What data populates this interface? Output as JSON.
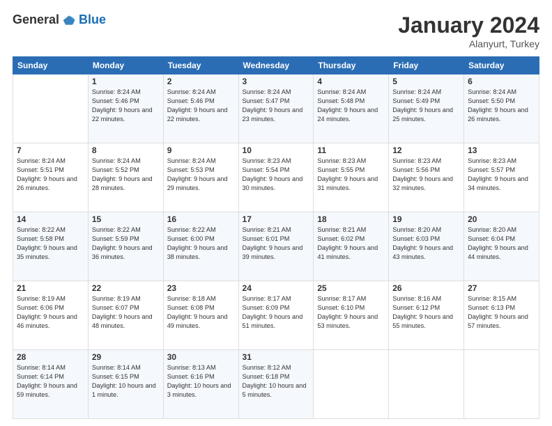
{
  "logo": {
    "general": "General",
    "blue": "Blue"
  },
  "header": {
    "month": "January 2024",
    "location": "Alanyurt, Turkey"
  },
  "weekdays": [
    "Sunday",
    "Monday",
    "Tuesday",
    "Wednesday",
    "Thursday",
    "Friday",
    "Saturday"
  ],
  "weeks": [
    [
      {
        "day": "",
        "sunrise": "",
        "sunset": "",
        "daylight": ""
      },
      {
        "day": "1",
        "sunrise": "Sunrise: 8:24 AM",
        "sunset": "Sunset: 5:46 PM",
        "daylight": "Daylight: 9 hours and 22 minutes."
      },
      {
        "day": "2",
        "sunrise": "Sunrise: 8:24 AM",
        "sunset": "Sunset: 5:46 PM",
        "daylight": "Daylight: 9 hours and 22 minutes."
      },
      {
        "day": "3",
        "sunrise": "Sunrise: 8:24 AM",
        "sunset": "Sunset: 5:47 PM",
        "daylight": "Daylight: 9 hours and 23 minutes."
      },
      {
        "day": "4",
        "sunrise": "Sunrise: 8:24 AM",
        "sunset": "Sunset: 5:48 PM",
        "daylight": "Daylight: 9 hours and 24 minutes."
      },
      {
        "day": "5",
        "sunrise": "Sunrise: 8:24 AM",
        "sunset": "Sunset: 5:49 PM",
        "daylight": "Daylight: 9 hours and 25 minutes."
      },
      {
        "day": "6",
        "sunrise": "Sunrise: 8:24 AM",
        "sunset": "Sunset: 5:50 PM",
        "daylight": "Daylight: 9 hours and 26 minutes."
      }
    ],
    [
      {
        "day": "7",
        "sunrise": "Sunrise: 8:24 AM",
        "sunset": "Sunset: 5:51 PM",
        "daylight": "Daylight: 9 hours and 26 minutes."
      },
      {
        "day": "8",
        "sunrise": "Sunrise: 8:24 AM",
        "sunset": "Sunset: 5:52 PM",
        "daylight": "Daylight: 9 hours and 28 minutes."
      },
      {
        "day": "9",
        "sunrise": "Sunrise: 8:24 AM",
        "sunset": "Sunset: 5:53 PM",
        "daylight": "Daylight: 9 hours and 29 minutes."
      },
      {
        "day": "10",
        "sunrise": "Sunrise: 8:23 AM",
        "sunset": "Sunset: 5:54 PM",
        "daylight": "Daylight: 9 hours and 30 minutes."
      },
      {
        "day": "11",
        "sunrise": "Sunrise: 8:23 AM",
        "sunset": "Sunset: 5:55 PM",
        "daylight": "Daylight: 9 hours and 31 minutes."
      },
      {
        "day": "12",
        "sunrise": "Sunrise: 8:23 AM",
        "sunset": "Sunset: 5:56 PM",
        "daylight": "Daylight: 9 hours and 32 minutes."
      },
      {
        "day": "13",
        "sunrise": "Sunrise: 8:23 AM",
        "sunset": "Sunset: 5:57 PM",
        "daylight": "Daylight: 9 hours and 34 minutes."
      }
    ],
    [
      {
        "day": "14",
        "sunrise": "Sunrise: 8:22 AM",
        "sunset": "Sunset: 5:58 PM",
        "daylight": "Daylight: 9 hours and 35 minutes."
      },
      {
        "day": "15",
        "sunrise": "Sunrise: 8:22 AM",
        "sunset": "Sunset: 5:59 PM",
        "daylight": "Daylight: 9 hours and 36 minutes."
      },
      {
        "day": "16",
        "sunrise": "Sunrise: 8:22 AM",
        "sunset": "Sunset: 6:00 PM",
        "daylight": "Daylight: 9 hours and 38 minutes."
      },
      {
        "day": "17",
        "sunrise": "Sunrise: 8:21 AM",
        "sunset": "Sunset: 6:01 PM",
        "daylight": "Daylight: 9 hours and 39 minutes."
      },
      {
        "day": "18",
        "sunrise": "Sunrise: 8:21 AM",
        "sunset": "Sunset: 6:02 PM",
        "daylight": "Daylight: 9 hours and 41 minutes."
      },
      {
        "day": "19",
        "sunrise": "Sunrise: 8:20 AM",
        "sunset": "Sunset: 6:03 PM",
        "daylight": "Daylight: 9 hours and 43 minutes."
      },
      {
        "day": "20",
        "sunrise": "Sunrise: 8:20 AM",
        "sunset": "Sunset: 6:04 PM",
        "daylight": "Daylight: 9 hours and 44 minutes."
      }
    ],
    [
      {
        "day": "21",
        "sunrise": "Sunrise: 8:19 AM",
        "sunset": "Sunset: 6:06 PM",
        "daylight": "Daylight: 9 hours and 46 minutes."
      },
      {
        "day": "22",
        "sunrise": "Sunrise: 8:19 AM",
        "sunset": "Sunset: 6:07 PM",
        "daylight": "Daylight: 9 hours and 48 minutes."
      },
      {
        "day": "23",
        "sunrise": "Sunrise: 8:18 AM",
        "sunset": "Sunset: 6:08 PM",
        "daylight": "Daylight: 9 hours and 49 minutes."
      },
      {
        "day": "24",
        "sunrise": "Sunrise: 8:17 AM",
        "sunset": "Sunset: 6:09 PM",
        "daylight": "Daylight: 9 hours and 51 minutes."
      },
      {
        "day": "25",
        "sunrise": "Sunrise: 8:17 AM",
        "sunset": "Sunset: 6:10 PM",
        "daylight": "Daylight: 9 hours and 53 minutes."
      },
      {
        "day": "26",
        "sunrise": "Sunrise: 8:16 AM",
        "sunset": "Sunset: 6:12 PM",
        "daylight": "Daylight: 9 hours and 55 minutes."
      },
      {
        "day": "27",
        "sunrise": "Sunrise: 8:15 AM",
        "sunset": "Sunset: 6:13 PM",
        "daylight": "Daylight: 9 hours and 57 minutes."
      }
    ],
    [
      {
        "day": "28",
        "sunrise": "Sunrise: 8:14 AM",
        "sunset": "Sunset: 6:14 PM",
        "daylight": "Daylight: 9 hours and 59 minutes."
      },
      {
        "day": "29",
        "sunrise": "Sunrise: 8:14 AM",
        "sunset": "Sunset: 6:15 PM",
        "daylight": "Daylight: 10 hours and 1 minute."
      },
      {
        "day": "30",
        "sunrise": "Sunrise: 8:13 AM",
        "sunset": "Sunset: 6:16 PM",
        "daylight": "Daylight: 10 hours and 3 minutes."
      },
      {
        "day": "31",
        "sunrise": "Sunrise: 8:12 AM",
        "sunset": "Sunset: 6:18 PM",
        "daylight": "Daylight: 10 hours and 5 minutes."
      },
      {
        "day": "",
        "sunrise": "",
        "sunset": "",
        "daylight": ""
      },
      {
        "day": "",
        "sunrise": "",
        "sunset": "",
        "daylight": ""
      },
      {
        "day": "",
        "sunrise": "",
        "sunset": "",
        "daylight": ""
      }
    ]
  ]
}
